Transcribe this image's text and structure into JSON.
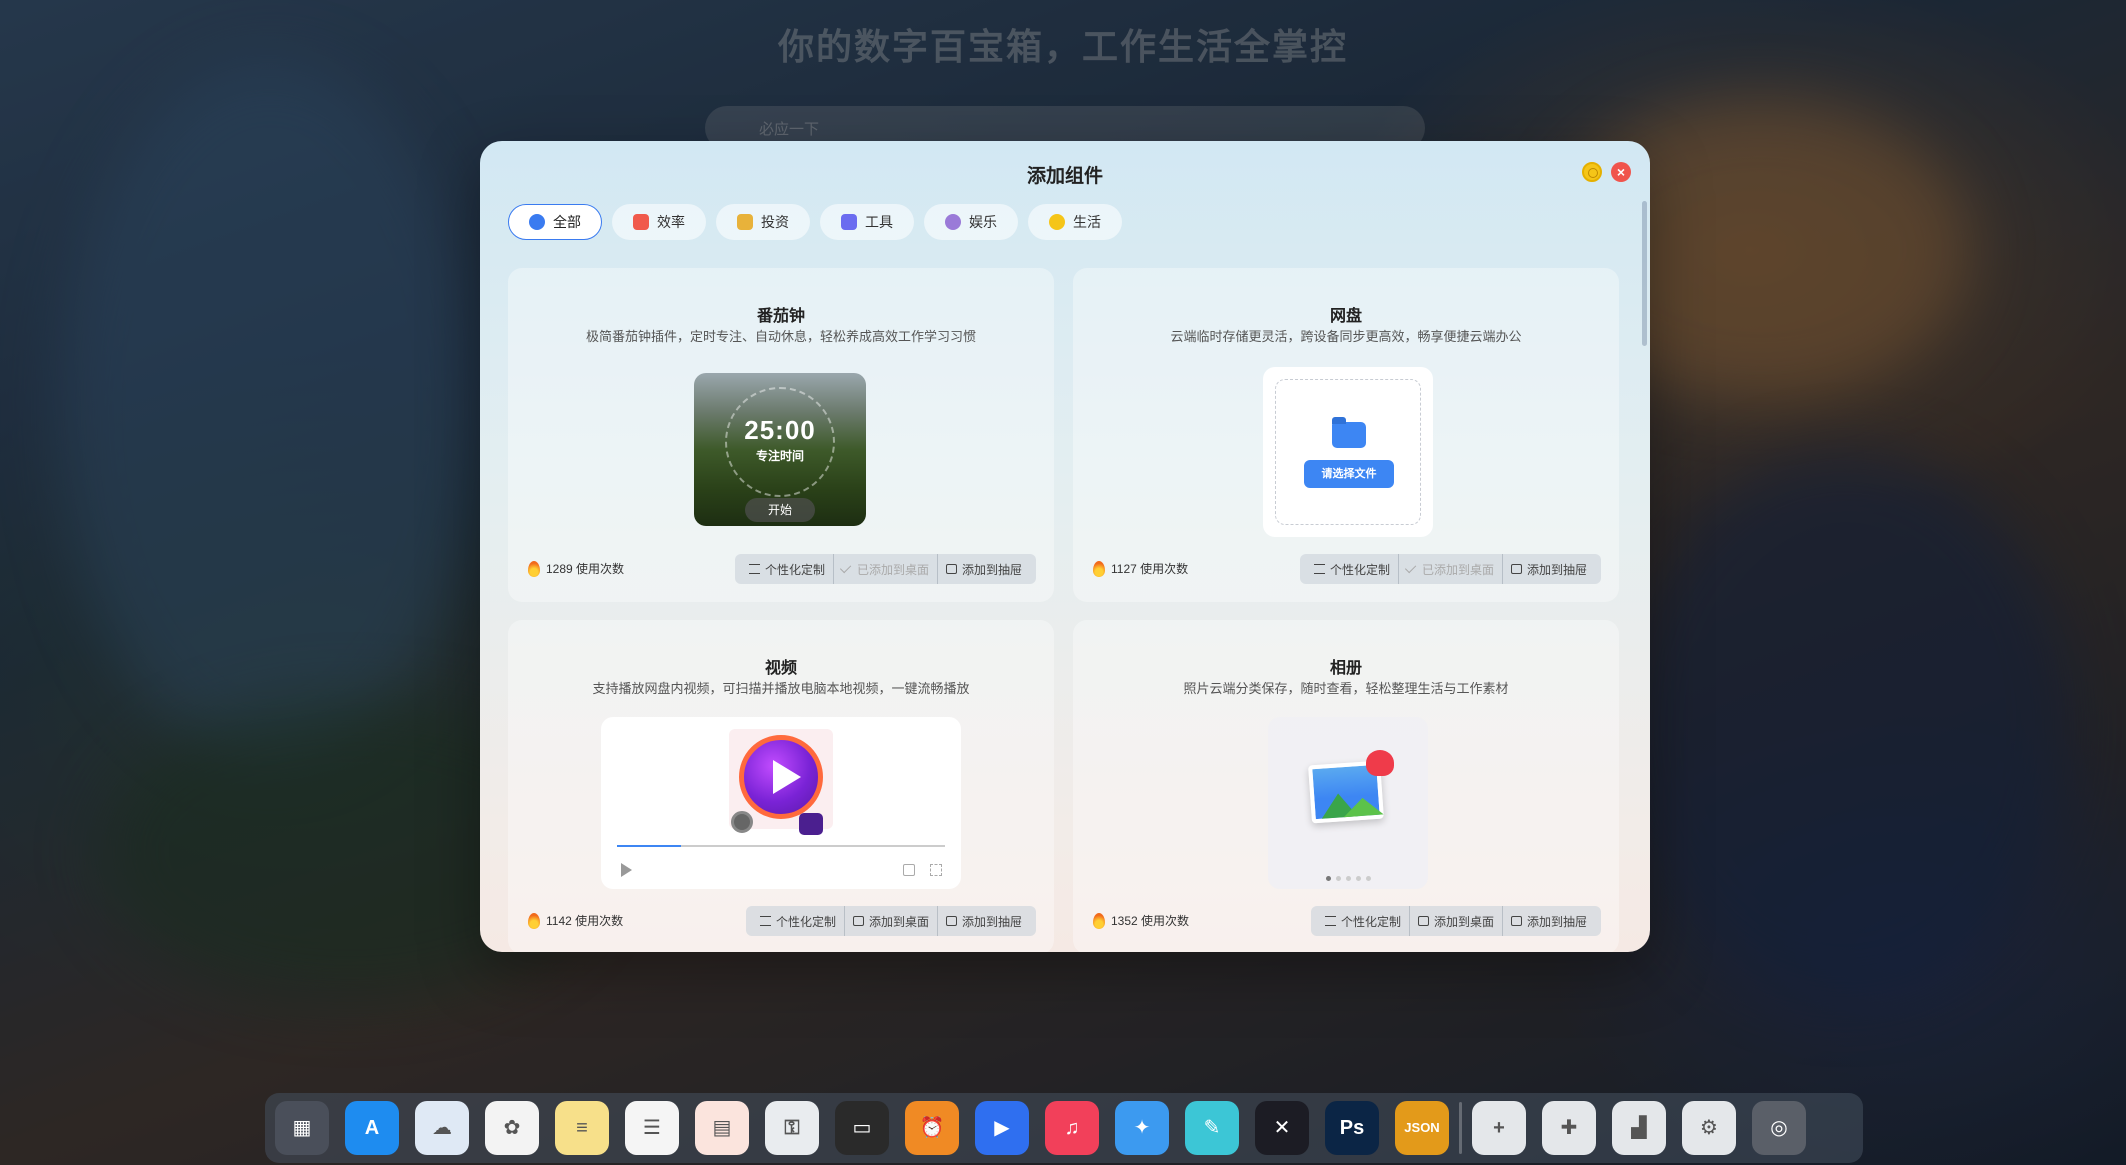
{
  "background": {
    "headline": "你的数字百宝箱，工作生活全掌控",
    "search_placeholder": "必应一下"
  },
  "modal": {
    "title": "添加组件",
    "tabs": [
      {
        "label": "全部",
        "active": true,
        "icon": "globe-icon",
        "color": "#3a7bf0"
      },
      {
        "label": "效率",
        "active": false,
        "icon": "rocket-icon",
        "color": "#f05a4c"
      },
      {
        "label": "投资",
        "active": false,
        "icon": "chart-icon",
        "color": "#e8b23a"
      },
      {
        "label": "工具",
        "active": false,
        "icon": "toolbox-icon",
        "color": "#6b6cf0"
      },
      {
        "label": "娱乐",
        "active": false,
        "icon": "headphones-icon",
        "color": "#9a7ad8"
      },
      {
        "label": "生活",
        "active": false,
        "icon": "bulb-icon",
        "color": "#f5c518"
      }
    ],
    "cards": [
      {
        "title": "番茄钟",
        "desc": "极简番茄钟插件，定时专注、自动休息，轻松养成高效工作学习习惯",
        "usage": "1289 使用次数",
        "actions": [
          "个性化定制",
          "已添加到桌面",
          "添加到抽屉"
        ],
        "preview": {
          "time": "25:00",
          "label": "专注时间",
          "button": "开始"
        }
      },
      {
        "title": "网盘",
        "desc": "云端临时存储更灵活，跨设备同步更高效，畅享便捷云端办公",
        "usage": "1127 使用次数",
        "actions": [
          "个性化定制",
          "已添加到桌面",
          "添加到抽屉"
        ],
        "preview": {
          "button": "请选择文件"
        }
      },
      {
        "title": "视频",
        "desc": "支持播放网盘内视频，可扫描并播放电脑本地视频，一键流畅播放",
        "usage": "1142 使用次数",
        "actions": [
          "个性化定制",
          "添加到桌面",
          "添加到抽屉"
        ]
      },
      {
        "title": "相册",
        "desc": "照片云端分类保存，随时查看，轻松整理生活与工作素材",
        "usage": "1352 使用次数",
        "actions": [
          "个性化定制",
          "添加到桌面",
          "添加到抽屉"
        ]
      }
    ]
  },
  "dock": {
    "apps": [
      {
        "name": "launchpad-icon",
        "color": "#4a4f5a",
        "glyph": "▦"
      },
      {
        "name": "app-store-icon",
        "color": "#1e8cf0",
        "glyph": "A"
      },
      {
        "name": "icloud-icon",
        "color": "#dfe9f5",
        "glyph": "☁"
      },
      {
        "name": "photos-icon",
        "color": "#f3f3f3",
        "glyph": "✿"
      },
      {
        "name": "notes-icon",
        "color": "#f7e08a",
        "glyph": "≡"
      },
      {
        "name": "reminders-icon",
        "color": "#f5f5f5",
        "glyph": "☰"
      },
      {
        "name": "calendar-icon",
        "color": "#fbe4dd",
        "glyph": "▤"
      },
      {
        "name": "keychain-icon",
        "color": "#e9ecef",
        "glyph": "⚿"
      },
      {
        "name": "wallet-icon",
        "color": "#2a2a2a",
        "glyph": "▭"
      },
      {
        "name": "clock-icon",
        "color": "#f08a24",
        "glyph": "⏰"
      },
      {
        "name": "video-player-icon",
        "color": "#2f6ff0",
        "glyph": "▶"
      },
      {
        "name": "music-icon",
        "color": "#f2405a",
        "glyph": "♫"
      },
      {
        "name": "safari-icon",
        "color": "#3c9af0",
        "glyph": "✦"
      },
      {
        "name": "pencil-icon",
        "color": "#3cc6d6",
        "glyph": "✎"
      },
      {
        "name": "mindmap-icon",
        "color": "#1c1c24",
        "glyph": "✕"
      },
      {
        "name": "photoshop-icon",
        "color": "#0b2545",
        "glyph": "Ps"
      },
      {
        "name": "json-tool-icon",
        "color": "#e39a1a",
        "glyph": "JSON"
      },
      {
        "name": "separator",
        "color": "",
        "glyph": ""
      },
      {
        "name": "add-widget-icon",
        "color": "#e4e7ea",
        "glyph": "+"
      },
      {
        "name": "plugin-icon",
        "color": "#e4e7ea",
        "glyph": "✚"
      },
      {
        "name": "brush-icon",
        "color": "#e4e7ea",
        "glyph": "▟"
      },
      {
        "name": "settings-gear-icon",
        "color": "#e4e7ea",
        "glyph": "⚙"
      },
      {
        "name": "system-icon",
        "color": "#5a5f68",
        "glyph": "◎"
      }
    ]
  }
}
